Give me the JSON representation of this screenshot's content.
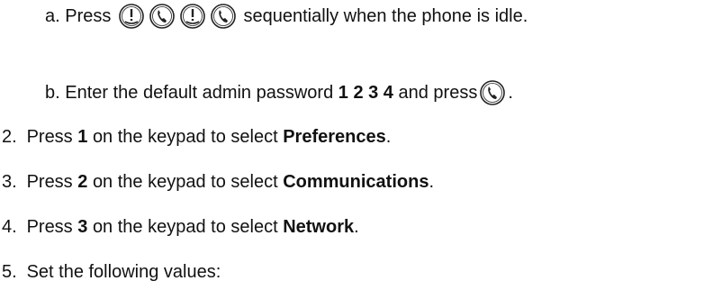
{
  "step_a": {
    "letter": "a.",
    "prefix": "Press",
    "keys": [
      "mute-key-icon",
      "handsfree-key-icon",
      "mute-key-icon",
      "handsfree-key-icon"
    ],
    "suffix": "sequentially when the phone is idle."
  },
  "step_b": {
    "letter": "b.",
    "prefix": "Enter the default admin password",
    "password": "1 2 3 4",
    "middle": "and press",
    "key": "handsfree-key-icon",
    "suffix": "."
  },
  "steps": [
    {
      "num": "2.",
      "pre": "Press",
      "key": "1",
      "mid": "on the keypad to select",
      "target": "Preferences",
      "end": "."
    },
    {
      "num": "3.",
      "pre": "Press",
      "key": "2",
      "mid": "on the keypad to select",
      "target": "Communications",
      "end": "."
    },
    {
      "num": "4.",
      "pre": "Press",
      "key": "3",
      "mid": "on the keypad to select",
      "target": "Network",
      "end": "."
    }
  ],
  "step5": {
    "num": "5.",
    "text": "Set the following values:"
  }
}
